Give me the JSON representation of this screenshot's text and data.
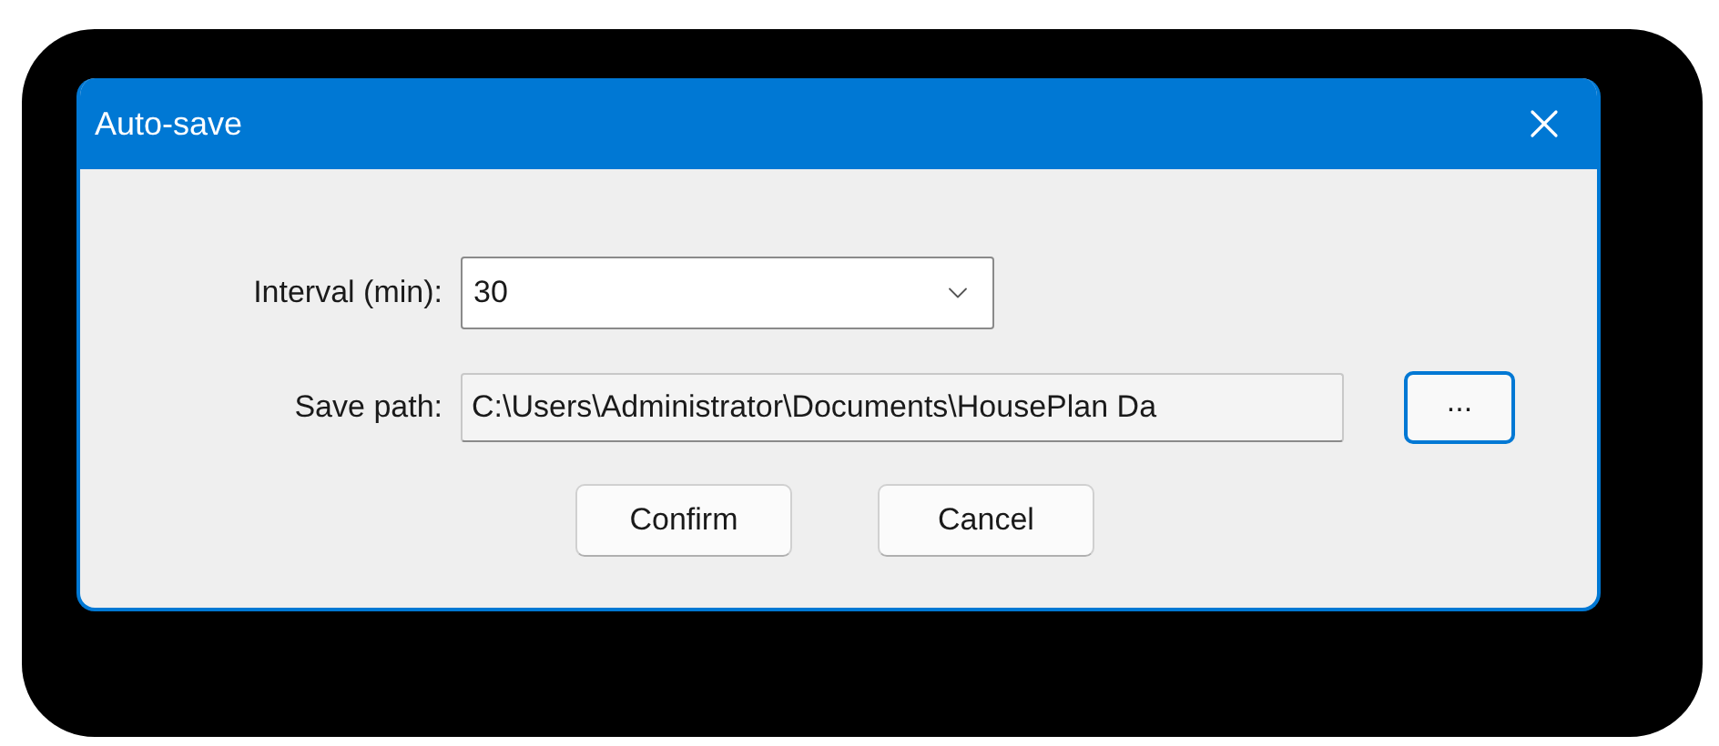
{
  "window": {
    "title": "Auto-save"
  },
  "interval": {
    "label": "Interval (min):",
    "value": "30"
  },
  "save_path": {
    "label": "Save path:",
    "value": "C:\\Users\\Administrator\\Documents\\HousePlan Da",
    "browse": "...",
    "read_only": true
  },
  "buttons": [
    "Confirm",
    "Cancel"
  ]
}
